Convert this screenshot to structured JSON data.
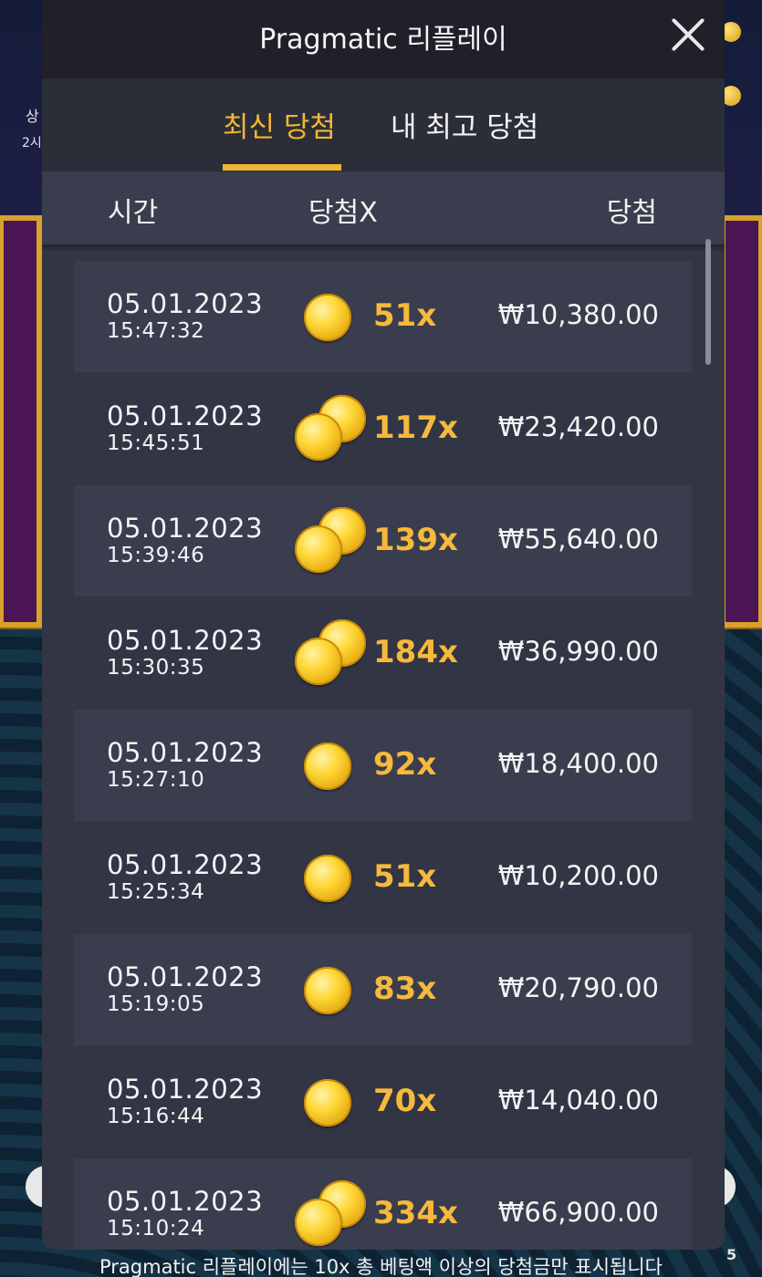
{
  "modal": {
    "title": "Pragmatic 리플레이",
    "close_icon": "close-icon"
  },
  "tabs": [
    {
      "label": "최신 당첨",
      "active": true
    },
    {
      "label": "내 최고 당첨",
      "active": false
    }
  ],
  "columns": {
    "time": "시간",
    "multiplier": "당첨X",
    "win": "당첨"
  },
  "rows": [
    {
      "date": "05.01.2023",
      "time": "15:47:32",
      "multiplier": "51x",
      "win": "₩10,380.00",
      "coins": 1
    },
    {
      "date": "05.01.2023",
      "time": "15:45:51",
      "multiplier": "117x",
      "win": "₩23,420.00",
      "coins": 2
    },
    {
      "date": "05.01.2023",
      "time": "15:39:46",
      "multiplier": "139x",
      "win": "₩55,640.00",
      "coins": 2
    },
    {
      "date": "05.01.2023",
      "time": "15:30:35",
      "multiplier": "184x",
      "win": "₩36,990.00",
      "coins": 2
    },
    {
      "date": "05.01.2023",
      "time": "15:27:10",
      "multiplier": "92x",
      "win": "₩18,400.00",
      "coins": 1
    },
    {
      "date": "05.01.2023",
      "time": "15:25:34",
      "multiplier": "51x",
      "win": "₩10,200.00",
      "coins": 1
    },
    {
      "date": "05.01.2023",
      "time": "15:19:05",
      "multiplier": "83x",
      "win": "₩20,790.00",
      "coins": 1
    },
    {
      "date": "05.01.2023",
      "time": "15:16:44",
      "multiplier": "70x",
      "win": "₩14,040.00",
      "coins": 1
    },
    {
      "date": "05.01.2023",
      "time": "15:10:24",
      "multiplier": "334x",
      "win": "₩66,900.00",
      "coins": 2
    }
  ],
  "background": {
    "left_text_1": "상",
    "left_text_2": "2시",
    "right_text": "5"
  },
  "footer": {
    "note": "Pragmatic 리플레이에는 10x 총 베팅액 이상의 당첨금만 표시됩니다"
  },
  "colors": {
    "accent": "#f2b632",
    "multiplier": "#f6b93b",
    "modal_bg": "#323544",
    "header_bg": "#1f2029"
  }
}
